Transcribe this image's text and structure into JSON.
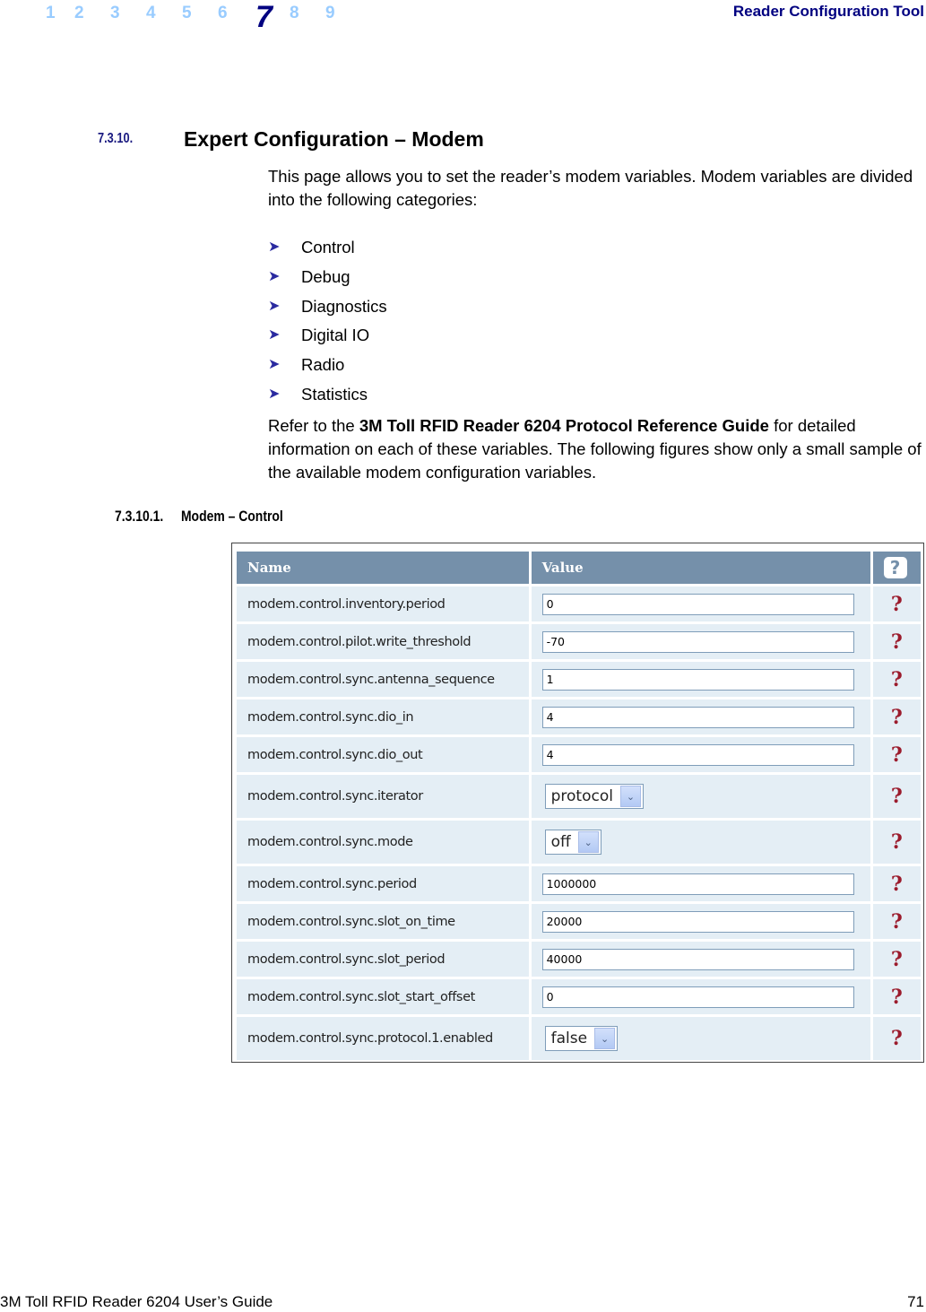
{
  "header": {
    "chapters": [
      "1",
      "2",
      "3",
      "4",
      "5",
      "6",
      "7",
      "8",
      "9"
    ],
    "active_chapter": "7",
    "title": "Reader Configuration Tool"
  },
  "section": {
    "number": "7.3.10.",
    "title": "Expert Configuration – Modem",
    "intro": "This page allows you to set the reader’s modem variables. Modem variables are divided into the following categories:",
    "categories": [
      "Control",
      "Debug",
      "Diagnostics",
      "Digital IO",
      "Radio",
      "Statistics"
    ],
    "refer_prefix": "Refer to the ",
    "refer_bold": "3M Toll RFID Reader 6204 Protocol Reference Guide",
    "refer_suffix": " for detailed information on each of these variables. The following figures show only a small sample of the available modem configuration variables."
  },
  "subsection": {
    "number": "7.3.10.1.",
    "title": "Modem – Control"
  },
  "table": {
    "headers": {
      "name": "Name",
      "value": "Value",
      "help": "?"
    },
    "help_glyph": "?",
    "rows": [
      {
        "name": "modem.control.inventory.period",
        "type": "text",
        "value": "0"
      },
      {
        "name": "modem.control.pilot.write_threshold",
        "type": "text",
        "value": "-70"
      },
      {
        "name": "modem.control.sync.antenna_sequence",
        "type": "text",
        "value": "1"
      },
      {
        "name": "modem.control.sync.dio_in",
        "type": "text",
        "value": "4"
      },
      {
        "name": "modem.control.sync.dio_out",
        "type": "text",
        "value": "4"
      },
      {
        "name": "modem.control.sync.iterator",
        "type": "select",
        "value": "protocol"
      },
      {
        "name": "modem.control.sync.mode",
        "type": "select",
        "value": "off"
      },
      {
        "name": "modem.control.sync.period",
        "type": "text",
        "value": "1000000"
      },
      {
        "name": "modem.control.sync.slot_on_time",
        "type": "text",
        "value": "20000"
      },
      {
        "name": "modem.control.sync.slot_period",
        "type": "text",
        "value": "40000"
      },
      {
        "name": "modem.control.sync.slot_start_offset",
        "type": "text",
        "value": "0"
      },
      {
        "name": "modem.control.sync.protocol.1.enabled",
        "type": "select",
        "value": "false"
      }
    ]
  },
  "footer": {
    "doc_title": "3M Toll RFID Reader 6204 User’s Guide",
    "page_number": "71"
  }
}
